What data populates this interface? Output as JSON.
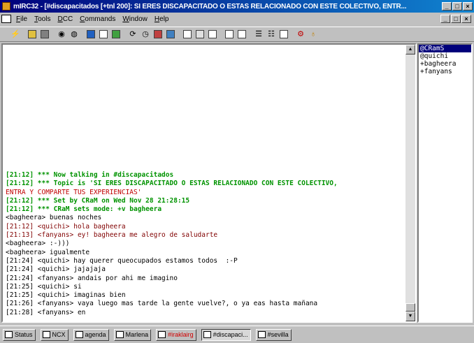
{
  "window": {
    "title": "mIRC32 - [#discapacitados [+tnl 200]: SI ERES DISCAPACITADO O ESTAS RELACIONADO CON ESTE COLECTIVO, ENTR...",
    "controls": [
      "_",
      "□",
      "×"
    ]
  },
  "menu": [
    "File",
    "Tools",
    "DCC",
    "Commands",
    "Window",
    "Help"
  ],
  "toolbar": {
    "icons": [
      "connect-icon",
      "folder-icon",
      "options-icon",
      "dcc-icon",
      "channels-icon",
      "list-icon",
      "finger-icon",
      "dcc-send-icon",
      "dcc-chat-icon",
      "notify-icon",
      "urls-icon",
      "address-icon",
      "remote-icon",
      "cascade-icon",
      "tile-icon",
      "tile-horiz-icon",
      "arrange-icon",
      "log-icon",
      "help-icon",
      "about-icon"
    ]
  },
  "colors": {
    "titlebar_start": "#00007b",
    "titlebar_end": "#1084d0",
    "log_green": "#009300",
    "log_red": "#c00000",
    "selection": "#00007b"
  },
  "chat": {
    "lines": [
      {
        "text": "[21:12] *** Now talking in #discapacitados",
        "style": "green"
      },
      {
        "text": "[21:12] *** Topic is 'SI ERES DISCAPACITADO O ESTAS RELACIONADO CON ESTE COLECTIVO,",
        "style": "green"
      },
      {
        "text": "ENTRA Y COMPARTE TUS EXPERIENCIAS'",
        "style": "red"
      },
      {
        "text": "[21:12] *** Set by CRaM on Wed Nov 28 21:28:15",
        "style": "green"
      },
      {
        "text": "[21:12] *** CRaM sets mode: +v bagheera",
        "style": "green"
      },
      {
        "text": "<bagheera> buenas noches",
        "style": "black"
      },
      {
        "text": "[21:12] <quichi> hola bagheera",
        "style": "dred"
      },
      {
        "text": "[21:13] <fanyans> ey! bagheera me alegro de saludarte",
        "style": "dred"
      },
      {
        "text": "<bagheera> :-)))",
        "style": "black"
      },
      {
        "text": "<bagheera> igualmente",
        "style": "black"
      },
      {
        "text": "[21:24] <quichi> hay querer queocupados estamos todos  :-P",
        "style": "black"
      },
      {
        "text": "[21:24] <quichi> jajajaja",
        "style": "black"
      },
      {
        "text": "[21:24] <fanyans> andais por ahi me imagino",
        "style": "black"
      },
      {
        "text": "[21:25] <quichi> si",
        "style": "black"
      },
      {
        "text": "[21:25] <quichi> imaginas bien",
        "style": "black"
      },
      {
        "text": "[21:26] <fanyans> vaya luego mas tarde la gente vuelve?, o ya eas hasta mañana",
        "style": "black"
      },
      {
        "text": "[21:28] <fanyans> en",
        "style": "black"
      }
    ]
  },
  "nicklist": [
    "@CRamS",
    "@quichi",
    "+bagheera",
    "+fanyans"
  ],
  "switchbar": [
    {
      "label": "Status",
      "state": "normal"
    },
    {
      "label": "NCX",
      "state": "normal"
    },
    {
      "label": "agenda",
      "state": "normal"
    },
    {
      "label": "Marlena",
      "state": "normal"
    },
    {
      "label": "#iraklairg",
      "state": "alert"
    },
    {
      "label": "#discapaci...",
      "state": "active"
    },
    {
      "label": "#sevilla",
      "state": "normal"
    }
  ]
}
